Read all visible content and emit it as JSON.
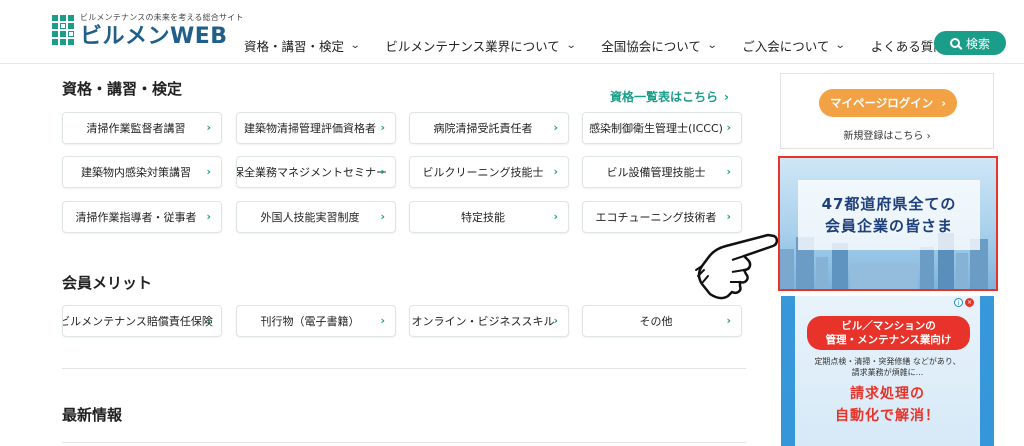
{
  "header": {
    "logo_tagline": "ビルメンテナンスの未来を考える総合サイト",
    "logo_name": "ビルメンWEB",
    "nav": [
      {
        "label": "資格・講習・検定",
        "has_dropdown": true
      },
      {
        "label": "ビルメンテナンス業界について",
        "has_dropdown": true
      },
      {
        "label": "全国協会について",
        "has_dropdown": true
      },
      {
        "label": "ご入会について",
        "has_dropdown": true
      },
      {
        "label": "よくある質問",
        "has_dropdown": false
      }
    ],
    "search_label": "検索",
    "chevron": "⌄"
  },
  "qualifications": {
    "title": "資格・講習・検定",
    "list_link": "資格一覧表はこちら",
    "items": [
      "清掃作業監督者講習",
      "建築物清掃管理評価資格者",
      "病院清掃受託責任者",
      "感染制御衛生管理士(ICCC)",
      "建築物内感染対策講習",
      "保全業務マネジメントセミナー",
      "ビルクリーニング技能士",
      "ビル設備管理技能士",
      "清掃作業指導者・従事者",
      "外国人技能実習制度",
      "特定技能",
      "エコチューニング技術者"
    ]
  },
  "benefits": {
    "title": "会員メリット",
    "items": [
      "ビルメンテナンス賠償責任保険",
      "刊行物（電子書籍）",
      "オンライン・ビジネススキル",
      "その他"
    ]
  },
  "news": {
    "title": "最新情報"
  },
  "sidebar": {
    "mypage_login": "マイページログイン",
    "register_link": "新規登録はこちら",
    "banner1": {
      "line1": "47都道府県全ての",
      "line2": "会員企業の皆さま"
    },
    "banner2": {
      "header_line1": "ビル／マンションの",
      "header_line2": "管理・メンテナンス業向け",
      "sub_line1": "定期点検・清掃・突発修繕 などがあり、",
      "sub_line2": "請求業務が煩雑に...",
      "main_line1": "請求処理の",
      "main_line2": "自動化で解消！"
    }
  },
  "colors": {
    "brand_teal": "#1a9e8a",
    "logo_blue": "#1f5f8a",
    "orange": "#f2a245",
    "red": "#e8332a",
    "ad_blue": "#1987d4"
  },
  "icons": {
    "arrow": "›",
    "pointer": "hand-pointer-icon"
  }
}
